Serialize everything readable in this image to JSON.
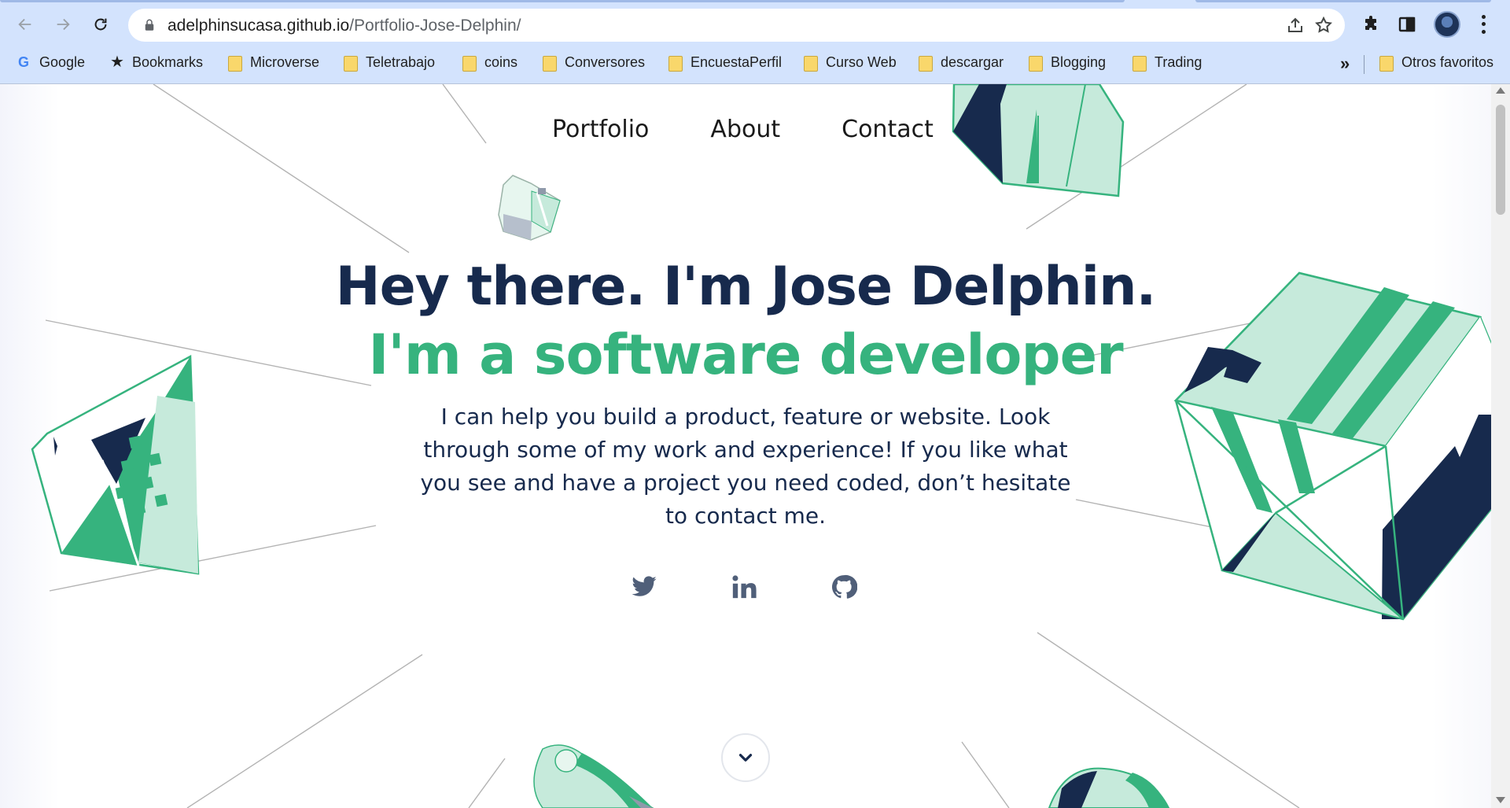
{
  "browser": {
    "url_host": "adelphinsucasa.github.io",
    "url_path": "/Portfolio-Jose-Delphin/",
    "nav_icons": [
      "back-icon",
      "forward-icon",
      "reload-icon"
    ],
    "toolbar_icons": [
      "share-icon",
      "bookmark-star-icon",
      "extensions-icon",
      "side-panel-icon",
      "profile-avatar",
      "menu-icon"
    ]
  },
  "bookmarks": {
    "items": [
      {
        "label": "Google",
        "icon": "google-icon"
      },
      {
        "label": "Bookmarks",
        "icon": "star-icon"
      },
      {
        "label": "Microverse",
        "icon": "folder-icon"
      },
      {
        "label": "Teletrabajo",
        "icon": "folder-icon"
      },
      {
        "label": "coins",
        "icon": "folder-icon"
      },
      {
        "label": "Conversores",
        "icon": "folder-icon"
      },
      {
        "label": "EncuestaPerfil",
        "icon": "folder-icon"
      },
      {
        "label": "Curso Web",
        "icon": "folder-icon"
      },
      {
        "label": "descargar",
        "icon": "folder-icon"
      },
      {
        "label": "Blogging",
        "icon": "folder-icon"
      },
      {
        "label": "Trading",
        "icon": "folder-icon"
      }
    ],
    "overflow": "»",
    "other": "Otros favoritos"
  },
  "site": {
    "nav": [
      "Portfolio",
      "About",
      "Contact"
    ],
    "title": "Hey there. I'm Jose Delphin.",
    "subtitle": "I'm a software developer",
    "body": "I can help you build a product, feature or website. Look through some of my work and experience! If you like what you see and have a project you need coded, don’t hesitate to contact me.",
    "socials": [
      "twitter-icon",
      "linkedin-icon",
      "github-icon"
    ],
    "scroll_icon": "chevron-down-icon"
  },
  "colors": {
    "navy": "#172a4d",
    "green": "#36b37e",
    "mint": "#c6eadb",
    "icon_gray": "#505f79",
    "chrome_bg": "#d3e3fd"
  }
}
